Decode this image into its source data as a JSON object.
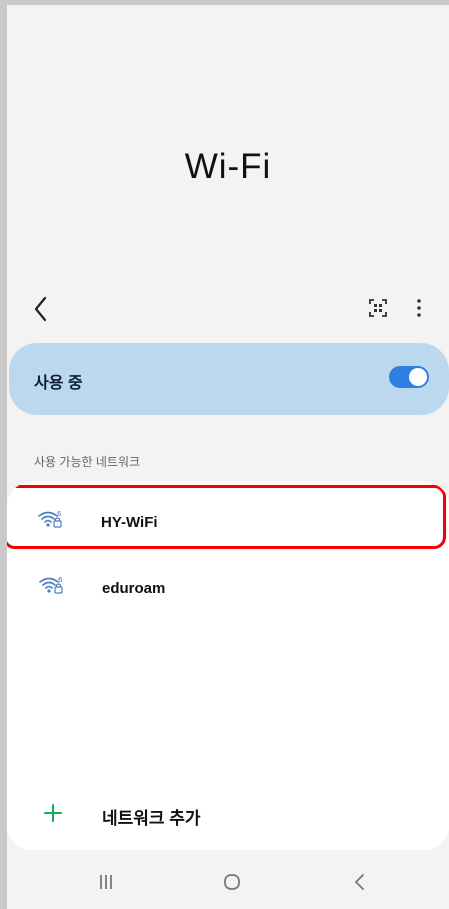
{
  "screen": {
    "title": "Wi-Fi"
  },
  "top_bar": {
    "back_icon": "chevron-left-icon",
    "qr_icon": "qr-code-icon",
    "more_icon": "more-vertical-icon"
  },
  "wifi_toggle": {
    "label": "사용 중",
    "enabled": true,
    "accent_color": "#2f7fe0",
    "card_color": "#bcd8ef"
  },
  "available_networks": {
    "section_label": "사용 가능한 네트워크",
    "items": [
      {
        "name": "HY-WiFi",
        "icon": "wifi-6-secured-icon",
        "highlighted": true
      },
      {
        "name": "eduroam",
        "icon": "wifi-6-secured-icon",
        "highlighted": false
      }
    ]
  },
  "add_network": {
    "label": "네트워크 추가",
    "icon": "plus-icon",
    "icon_color": "#14a85a"
  },
  "system_nav": {
    "recents_icon": "recents-icon",
    "home_icon": "home-icon",
    "back_icon": "back-icon"
  },
  "highlight": {
    "color": "#f40000"
  }
}
